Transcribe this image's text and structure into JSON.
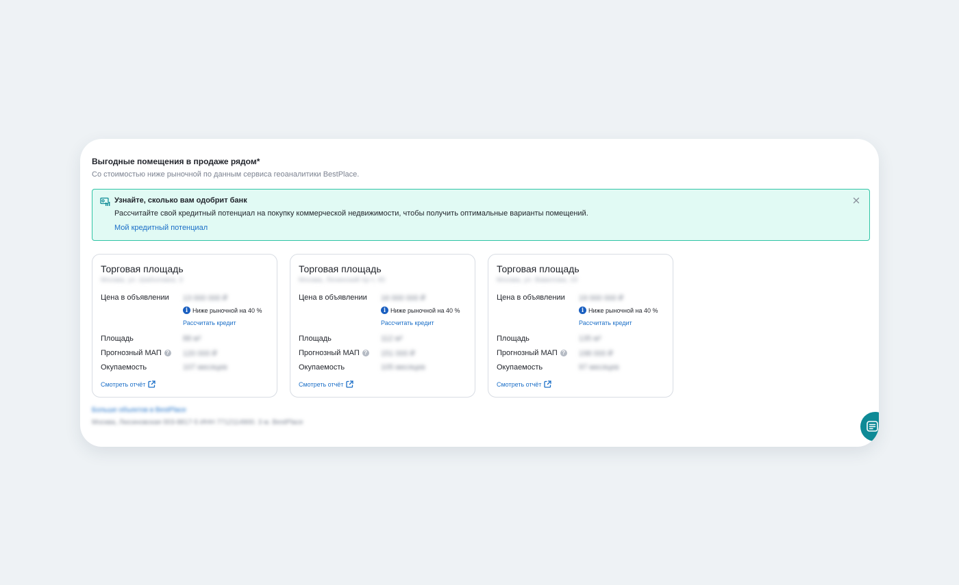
{
  "section": {
    "title": "Выгодные помещения в продаже рядом*",
    "subtitle": "Со стоимостью ниже рыночной по данным сервиса геоаналитики BestPlace."
  },
  "banner": {
    "icon": "credit-calculator-icon",
    "title": "Узнайте, сколько вам одобрит банк",
    "text": "Рассчитайте свой кредитный потенциал на покупку коммерческой недвижимости, чтобы получить оптимальные варианты помещений.",
    "link": "Мой кредитный потенциал",
    "close_icon": "close-icon"
  },
  "labels": {
    "price": "Цена в объявлении",
    "below_market": "Ниже рыночной на 40 %",
    "calc_credit": "Рассчитать кредит",
    "area": "Площадь",
    "forecast_rent": "Прогнозный МАП",
    "payback": "Окупаемость",
    "report": "Смотреть отчёт"
  },
  "cards": [
    {
      "title": "Торговая площадь",
      "address": "Москва, ул. Шаболовка, 3",
      "price": "13 000 000 ₽",
      "area": "88 м²",
      "forecast_rent": "120 000 ₽",
      "payback": "107 месяцев"
    },
    {
      "title": "Торговая площадь",
      "address": "Москва, Ленинский пр-т, 45",
      "price": "16 000 000 ₽",
      "area": "112 м²",
      "forecast_rent": "151 000 ₽",
      "payback": "105 месяцев"
    },
    {
      "title": "Торговая площадь",
      "address": "Москва, ул. Вавилова, 19",
      "price": "19 000 000 ₽",
      "area": "135 м²",
      "forecast_rent": "198 000 ₽",
      "payback": "97 месяцев"
    }
  ],
  "footnote": {
    "link": "Больше объектов в BestPlace",
    "text": "Москва, Люсиновская 003-8817-5 ИНН 7712114900. 3 м. BestPlace"
  },
  "chat_button": {
    "icon": "chat-icon"
  },
  "colors": {
    "accent_teal": "#0e8a96",
    "banner_bg": "#e1faf4",
    "banner_border": "#2fc4a5",
    "link_blue": "#1a6ec7"
  }
}
